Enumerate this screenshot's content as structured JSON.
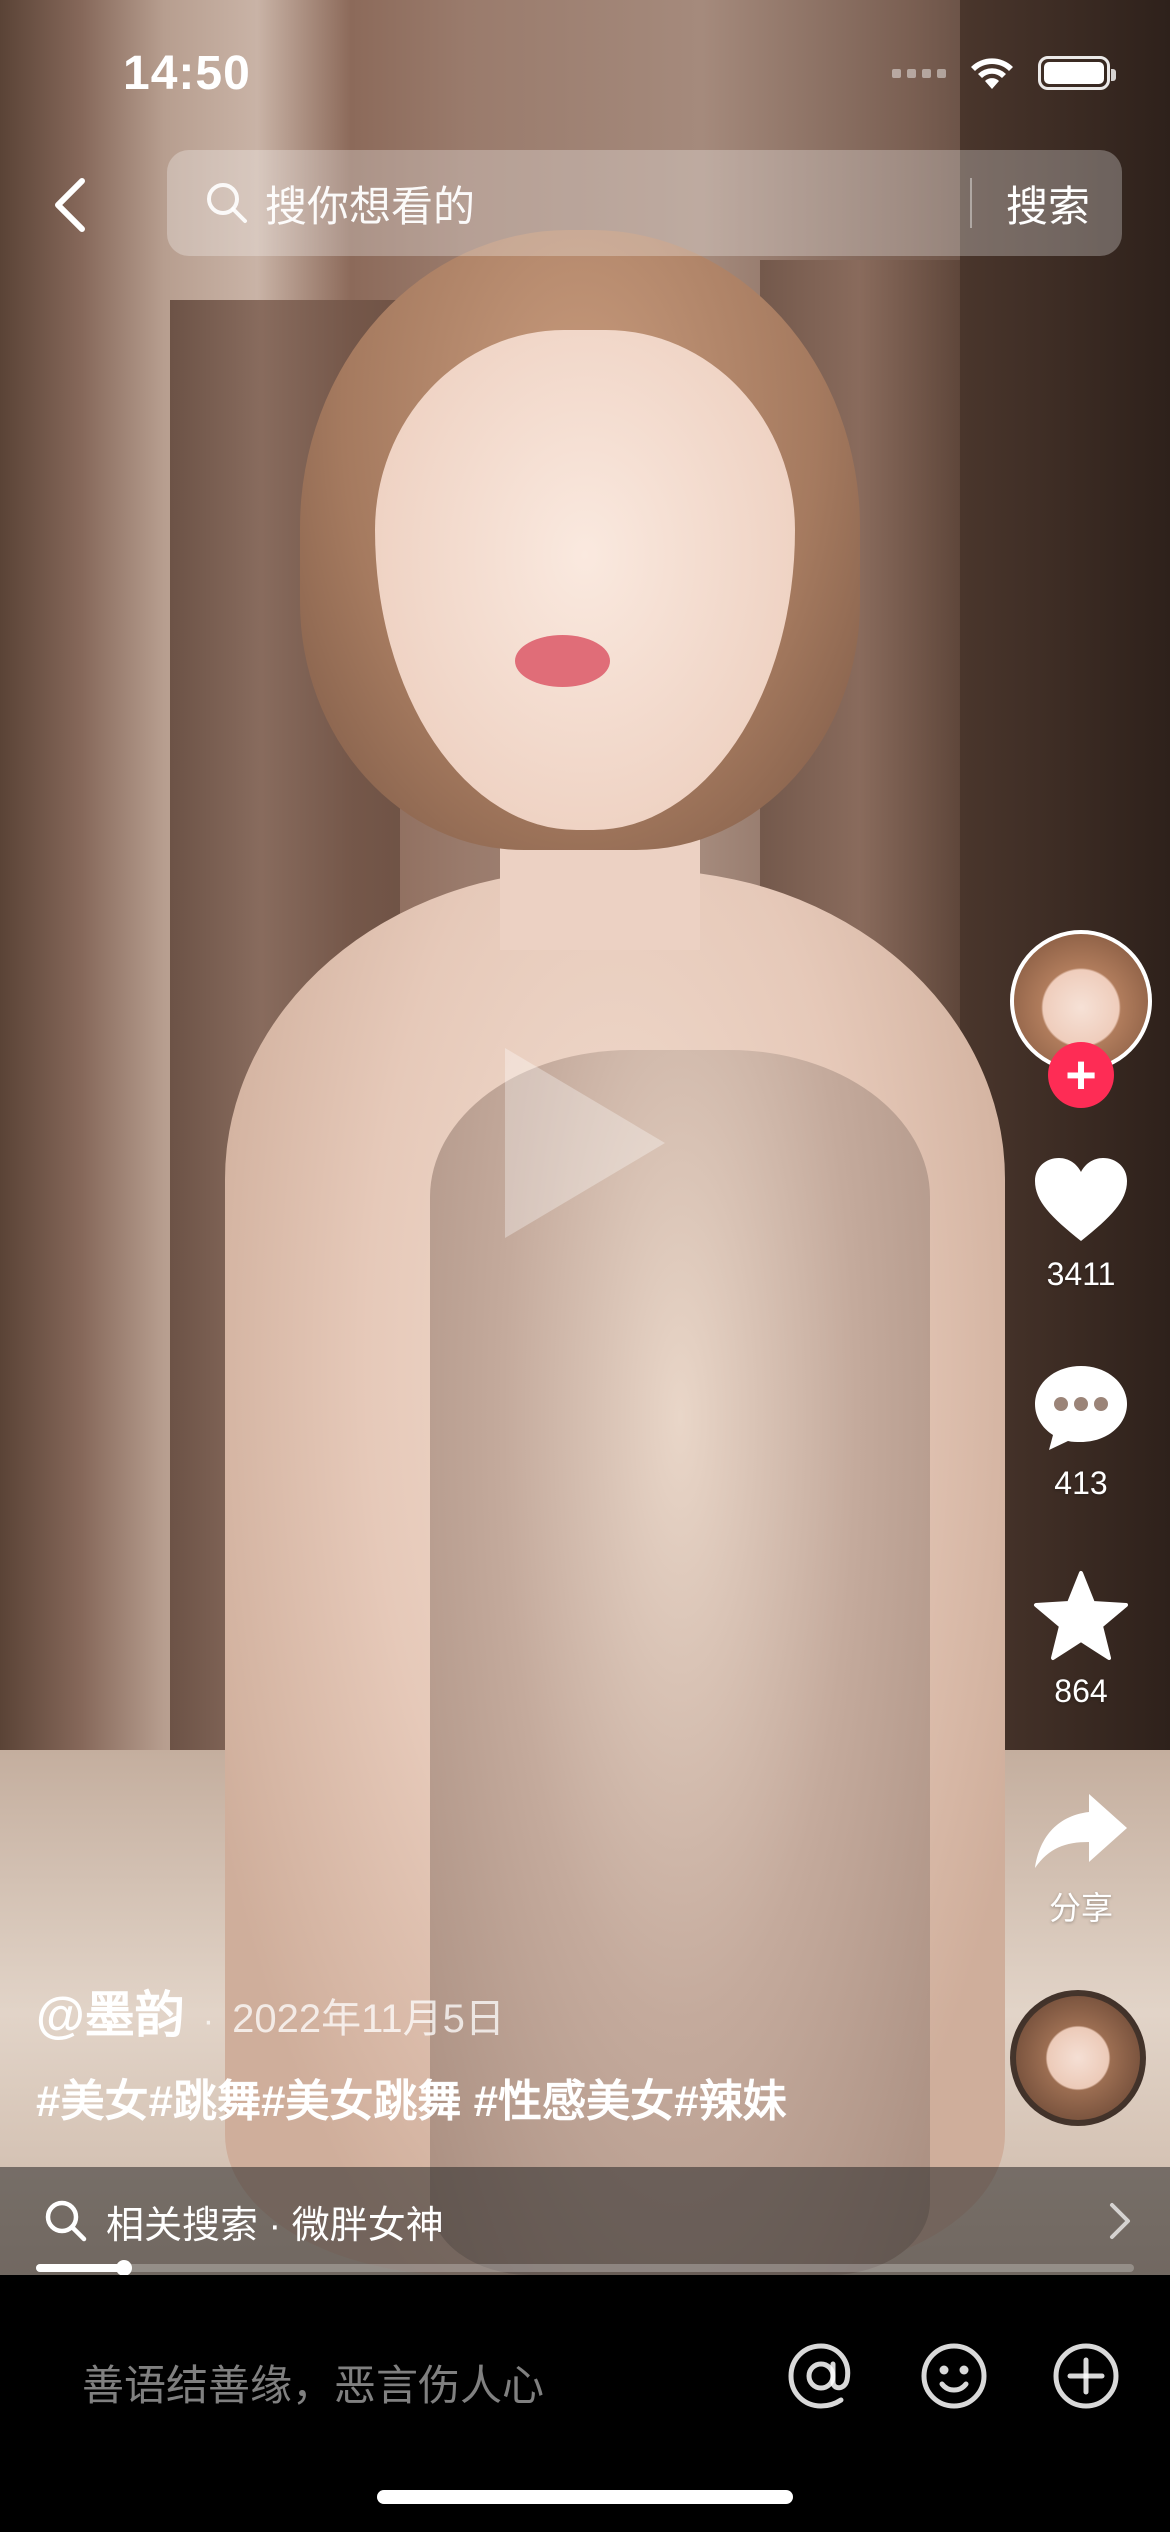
{
  "status_bar": {
    "time": "14:50"
  },
  "header": {
    "search_placeholder": "搜你想看的",
    "search_button": "搜索"
  },
  "actions": {
    "follow_symbol": "+",
    "likes": "3411",
    "comments": "413",
    "favorites": "864",
    "share": "分享"
  },
  "post": {
    "author": "@墨韵",
    "separator": "·",
    "date": "2022年11月5日",
    "hashtags": "#美女#跳舞#美女跳舞 #性感美女#辣妹"
  },
  "related_search": {
    "label": "相关搜索 · 微胖女神"
  },
  "playback": {
    "progress": 0.08
  },
  "comment_bar": {
    "placeholder": "善语结善缘，恶言伤人心"
  },
  "colors": {
    "follow_accent": "#fe2c55",
    "bottom_bar": "#000000"
  },
  "icons": [
    "back-icon",
    "search-icon",
    "play-icon",
    "heart-icon",
    "comment-icon",
    "star-icon",
    "share-icon",
    "chevron-right-icon",
    "at-icon",
    "emoji-icon",
    "add-icon"
  ]
}
